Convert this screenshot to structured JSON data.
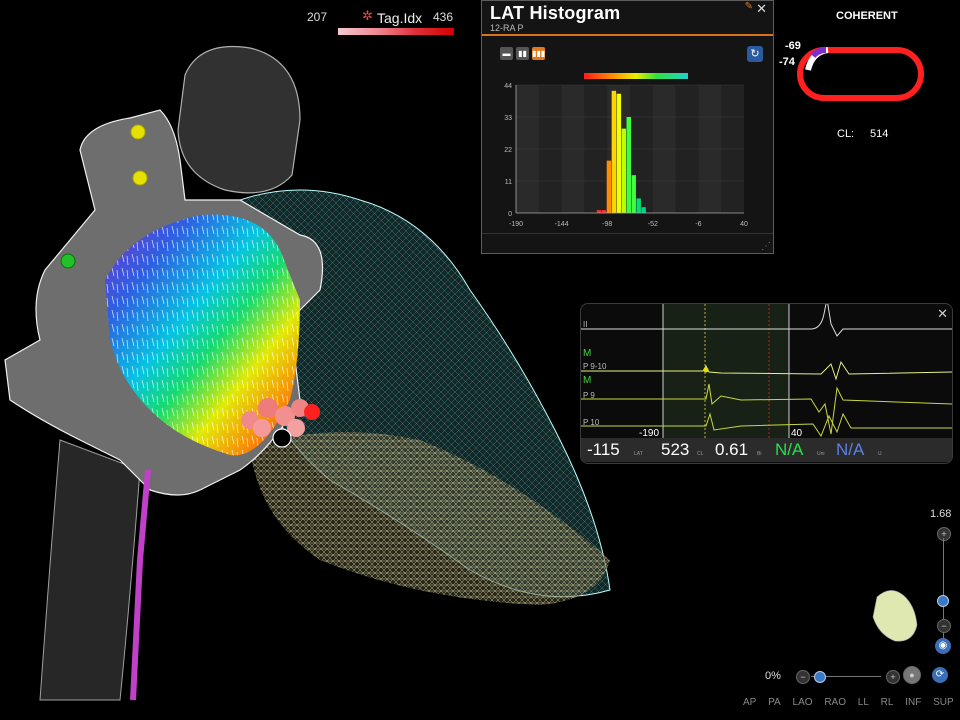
{
  "tag_index": {
    "min": "207",
    "max": "436",
    "title": "Tag.Idx"
  },
  "histogram": {
    "title": "LAT Histogram",
    "subtitle": "12-RA P",
    "view_buttons": [
      "single",
      "dual",
      "triple"
    ],
    "y_ticks": [
      "44",
      "33",
      "22",
      "11",
      "0"
    ],
    "x_ticks": [
      "-190",
      "-144",
      "-98",
      "-52",
      "-6",
      "40"
    ]
  },
  "chart_data": {
    "type": "bar",
    "x": [
      -106,
      -101,
      -96,
      -91,
      -86,
      -81,
      -76,
      -71,
      -66,
      -61
    ],
    "values": [
      1,
      1,
      18,
      42,
      41,
      29,
      33,
      13,
      5,
      2
    ],
    "bar_colors": [
      "#ff2a2a",
      "#ff2a2a",
      "#ff8c00",
      "#ffd400",
      "#f2ff00",
      "#b8ff00",
      "#3fff3f",
      "#3fff3f",
      "#00e070",
      "#00d68a"
    ],
    "xlim": [
      -190,
      40
    ],
    "ylim": [
      0,
      44
    ]
  },
  "coherent": {
    "title": "COHERENT",
    "value_top": "-69",
    "value_bottom": "-74",
    "cl_label": "CL:",
    "cl_value": "514"
  },
  "egm": {
    "labels": {
      "lead_ii": "II",
      "m1": "M",
      "p910": "P 9-10",
      "m2": "M",
      "p9": "P 9",
      "p10": "P 10"
    },
    "tick_left": "-190",
    "tick_right": "40",
    "readout": {
      "lat": "-115",
      "lat_unit": "LAT",
      "cl": "523",
      "cl_unit": "CL",
      "bi": "0.61",
      "bi_unit": "Bi",
      "na1": "N/A",
      "na1_unit": "Uni",
      "na2": "N/A",
      "na2_unit": "U"
    }
  },
  "zoom": {
    "value": "1.68",
    "percent": "0%"
  },
  "view_buttons": [
    "AP",
    "PA",
    "LAO",
    "RAO",
    "LL",
    "RL",
    "INF",
    "SUP"
  ],
  "colors": {
    "accent": "#e07a20",
    "panel_bg": "#141414",
    "lat_green": "#28e04a",
    "lat_blue": "#5b80e8"
  }
}
